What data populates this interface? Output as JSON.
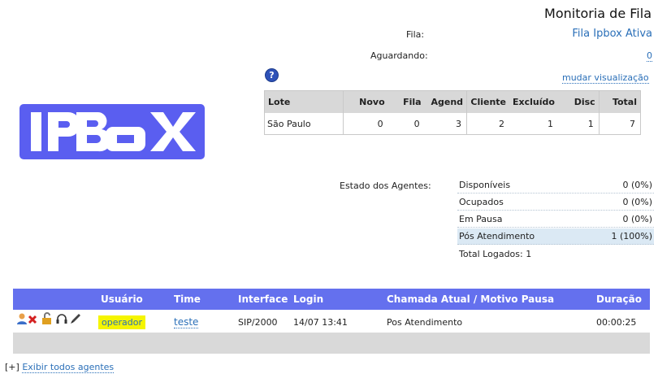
{
  "header": {
    "title": "Monitoria de Fila"
  },
  "queue": {
    "label": "Fila:",
    "value": "Fila Ipbox Ativa"
  },
  "waiting": {
    "label": "Aguardando:",
    "value": "0"
  },
  "toolbar": {
    "help_glyph": "?",
    "change_view": "mudar visualização"
  },
  "logo": {
    "text": "IPBOX"
  },
  "lote_table": {
    "headers": [
      "Lote",
      "Novo",
      "Fila",
      "Agend",
      "Cliente",
      "Excluído",
      "Disc",
      "Total"
    ],
    "rows": [
      [
        "São Paulo",
        "0",
        "0",
        "3",
        "2",
        "1",
        "1",
        "7"
      ]
    ]
  },
  "agents_status": {
    "label": "Estado dos Agentes:",
    "items": [
      {
        "name": "Disponíveis",
        "value": "0 (0%)"
      },
      {
        "name": "Ocupados",
        "value": "0 (0%)"
      },
      {
        "name": "Em Pausa",
        "value": "0 (0%)"
      },
      {
        "name": "Pós Atendimento",
        "value": "1 (100%)"
      }
    ],
    "total": "Total Logados: 1"
  },
  "agents_table": {
    "headers": [
      "Usuário",
      "Time",
      "Interface",
      "Login",
      "Chamada Atual / Motivo Pausa",
      "Duração"
    ],
    "rows": [
      {
        "user": "operador",
        "team": "teste",
        "interface": "SIP/2000",
        "login": "14/07 13:41",
        "call": "Pos Atendimento",
        "duration": "00:00:25"
      }
    ],
    "row_icons": [
      "user-icon",
      "remove-icon",
      "unlock-icon",
      "headset-icon",
      "microphone-icon"
    ]
  },
  "footer": {
    "toggle": "[+]",
    "show_all": "Exibir todos agentes"
  },
  "colors": {
    "header_bg": "#6470ee",
    "logo_bg": "#5a5ef0",
    "link": "#2a6fb8",
    "highlight": "#f5f500"
  }
}
